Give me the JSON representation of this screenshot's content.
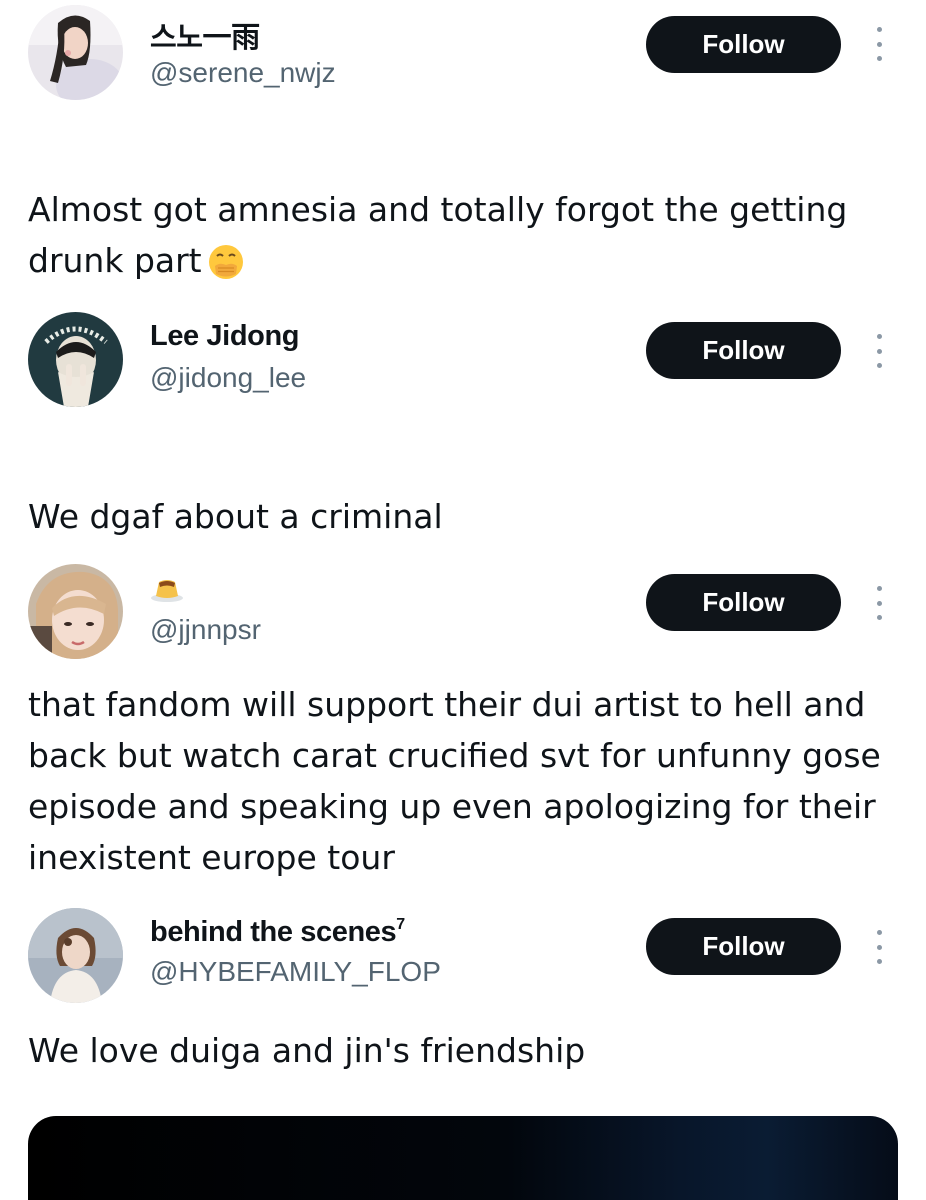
{
  "posts": [
    {
      "display_name": "스노一雨",
      "handle": "@serene_nwjz",
      "follow_label": "Follow",
      "text": "Almost got amnesia and totally forgot the getting drunk part",
      "text_emoji": "face-with-hand-over-mouth-emoji"
    },
    {
      "display_name": "Lee Jidong",
      "handle": "@jidong_lee",
      "follow_label": "Follow",
      "text": "We dgaf about a criminal"
    },
    {
      "display_name_emoji": "custard-pudding-emoji",
      "handle": "@jjnnpsr",
      "follow_label": "Follow",
      "text": "that fandom will support their dui artist to hell and back but watch carat crucified svt for unfunny gose episode and speaking up even apologizing for their inexistent europe tour"
    },
    {
      "display_name": "behind the scenes",
      "display_name_sup": "7",
      "handle": "@HYBEFAMILY_FLOP",
      "follow_label": "Follow",
      "text": "We love duiga and jin's friendship"
    }
  ],
  "colors": {
    "follow_button_bg": "#0f1419",
    "follow_button_text": "#ffffff",
    "handle": "#536471",
    "more_dots": "#8b98a5"
  },
  "icons": [
    "more-options-icon"
  ]
}
